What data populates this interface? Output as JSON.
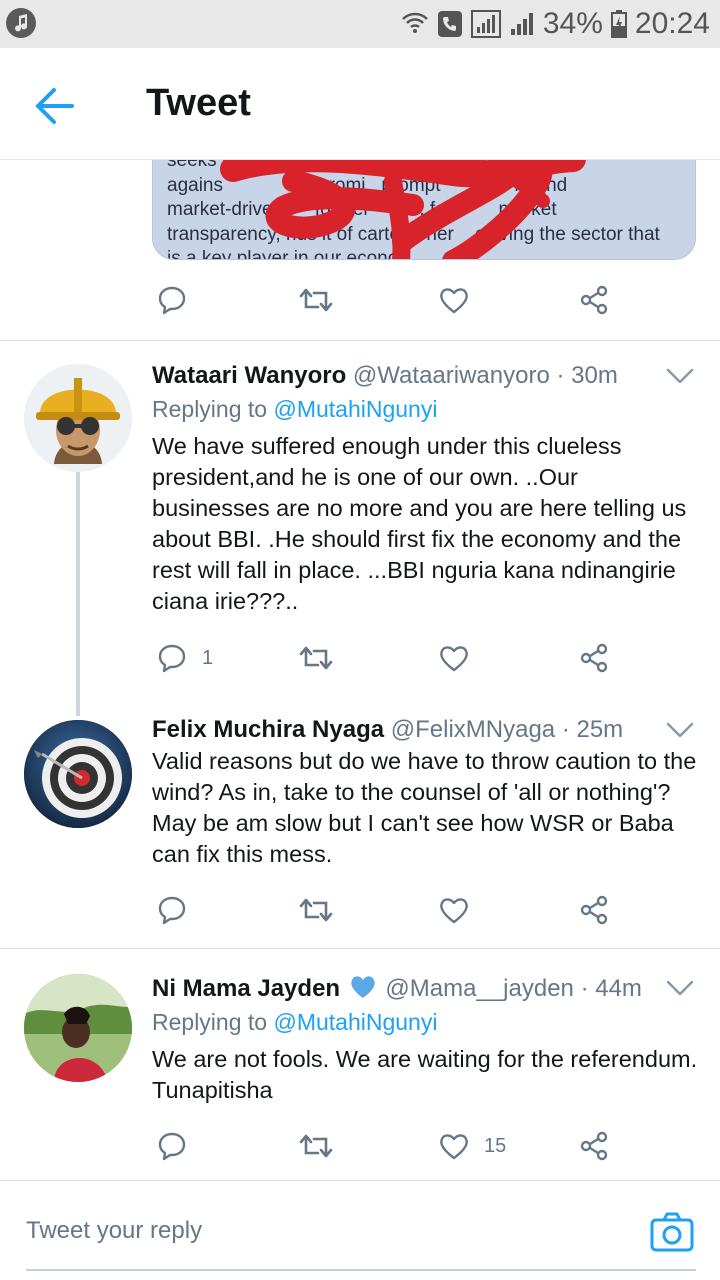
{
  "status_bar": {
    "battery": "34%",
    "time": "20:24",
    "icons": [
      "music-note-icon",
      "wifi-icon",
      "phone-icon",
      "signal-icon",
      "signal-icon",
      "battery-charging-icon"
    ]
  },
  "header": {
    "title": "Tweet",
    "back_icon": "arrow-left-icon"
  },
  "quoted_tweet": {
    "lines": [
      "seeks t...ector and protect farmers",
      "against...promising prompt...m and",
      "market-drive...for deliveries, for market",
      "transparency, rids it of carte...he...reviving the sector that",
      "is a key player in our econo..."
    ],
    "line1": "seeks t        ctor and protect farmers",
    "line2": "agains                  promi   prompt              m and",
    "line3": "market-drive        for del    ries, fo          market",
    "line4": "transparency, rids it of carte     her    eviving the sector that",
    "line5": "is a key player in our econo"
  },
  "tweets": [
    {
      "name": "Wataari Wanyoro",
      "handle": "@Wataariwanyoro",
      "time": "· 30m",
      "replying_label": "Replying to",
      "replying_to": "@MutahiNgunyi",
      "body": "We have suffered enough under this  clueless president,and he is one of our own. ..Our businesses are no more and you are here telling us about BBI. .He should first fix the economy and the rest will fall in place. ...BBI nguria kana ndinangirie ciana irie???..",
      "reply_count": "1",
      "retweet_count": "",
      "like_count": ""
    },
    {
      "name": "Felix Muchira Nyaga",
      "handle": "@FelixMNyaga",
      "time": "· 25m",
      "body": "Valid reasons but do we have to throw caution to the wind? As in, take to the counsel of 'all or nothing'? May be am slow but I can't see how WSR or Baba can fix this mess.",
      "reply_count": "",
      "retweet_count": "",
      "like_count": ""
    },
    {
      "name": "Ni Mama Jayden",
      "handle": "@Mama__jayden",
      "time": "· 44m",
      "replying_label": "Replying to",
      "replying_to": "@MutahiNgunyi",
      "body": "We are not fools. We are waiting for the referendum. Tunapitisha",
      "reply_count": "",
      "retweet_count": "",
      "like_count": "15"
    }
  ],
  "reply_bar": {
    "placeholder": "Tweet your reply",
    "camera_icon": "camera-icon"
  },
  "colors": {
    "accent": "#1da1f2",
    "secondary_text": "#657786",
    "scribble": "#d8232a",
    "heart_badge": "#1da1f2"
  }
}
